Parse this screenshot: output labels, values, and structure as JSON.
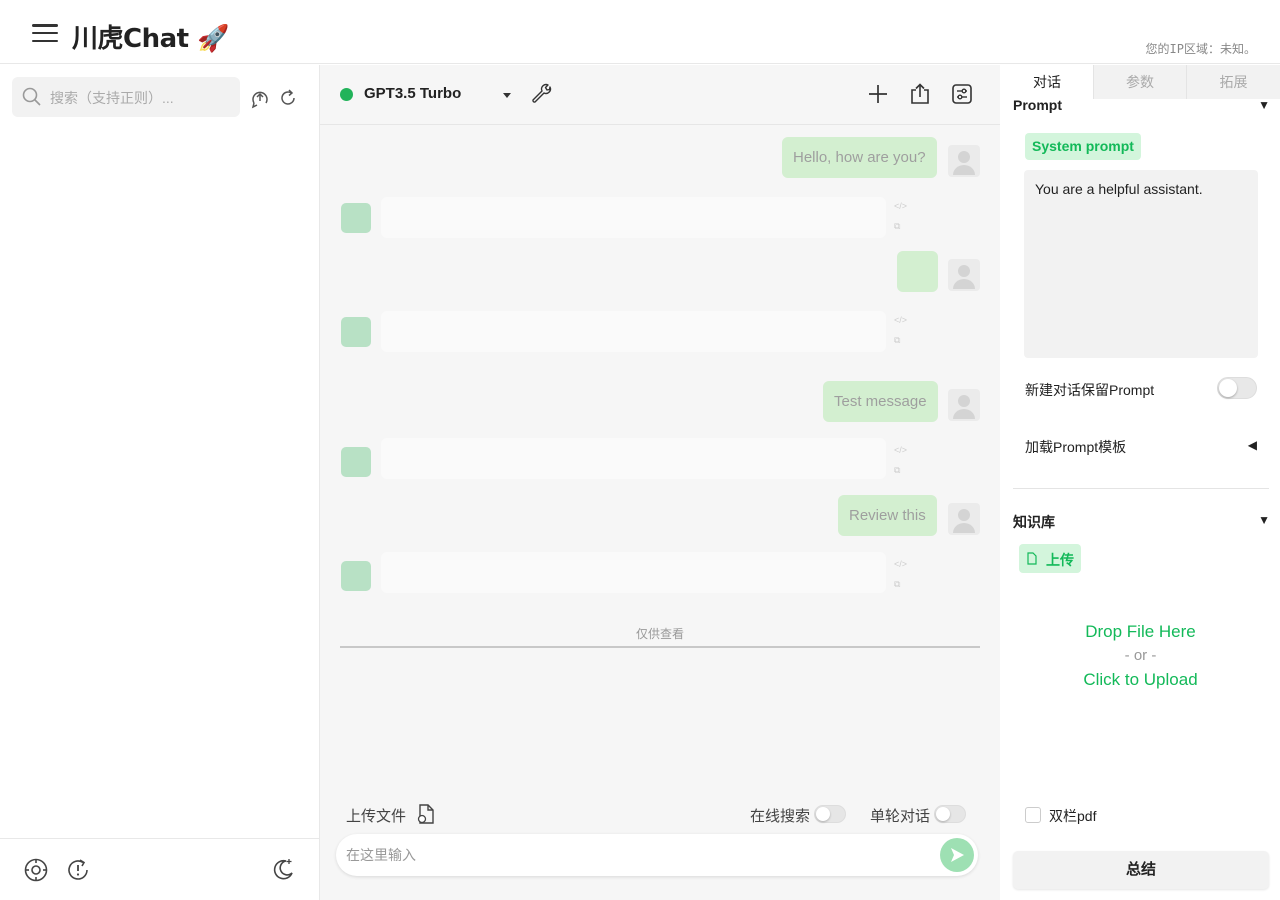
{
  "header": {
    "title": "川虎Chat 🚀",
    "ip_text": "您的IP区域：未知。"
  },
  "sidebar": {
    "search_placeholder": "搜索（支持正则）..."
  },
  "chat": {
    "model_name": "GPT3.5 Turbo",
    "status_color": "#22b35a",
    "messages": [
      {
        "role": "user",
        "text": "Hello, how are you?"
      },
      {
        "role": "assistant",
        "text": ""
      },
      {
        "role": "user",
        "text": ""
      },
      {
        "role": "assistant",
        "text": ""
      },
      {
        "role": "user",
        "text": "Test message"
      },
      {
        "role": "assistant",
        "text": ""
      },
      {
        "role": "user",
        "text": "Review this"
      },
      {
        "role": "assistant",
        "text": ""
      }
    ],
    "view_only_label": "仅供查看",
    "upload_file_label": "上传文件",
    "online_search_label": "在线搜索",
    "single_turn_label": "单轮对话",
    "input_placeholder": "在这里输入"
  },
  "right_panel": {
    "tabs": [
      "对话",
      "参数",
      "拓展"
    ],
    "prompt_section_title": "Prompt",
    "system_prompt_label": "System prompt",
    "system_prompt_value": "You are a helpful assistant.",
    "keep_prompt_label": "新建对话保留Prompt",
    "load_template_label": "加载Prompt模板",
    "knowledge_title": "知识库",
    "upload_label": "上传",
    "drop_file": "Drop File Here",
    "drop_or": "- or -",
    "click_upload": "Click to Upload",
    "two_column_pdf_label": "双栏pdf",
    "summarize_label": "总结",
    "accent_color": "#13b959"
  }
}
